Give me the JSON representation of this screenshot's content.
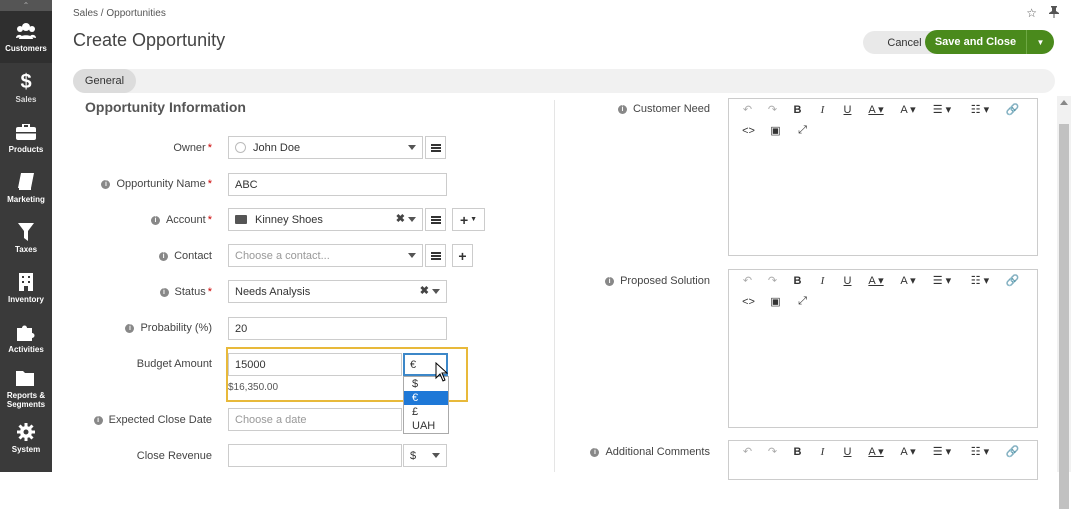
{
  "sidebar": {
    "items": [
      {
        "label": "Customers",
        "icon": "users-icon"
      },
      {
        "label": "Sales",
        "icon": "dollar-icon"
      },
      {
        "label": "Products",
        "icon": "briefcase-icon"
      },
      {
        "label": "Marketing",
        "icon": "book-icon"
      },
      {
        "label": "Taxes",
        "icon": "filter-icon"
      },
      {
        "label": "Inventory",
        "icon": "building-icon"
      },
      {
        "label": "Activities",
        "icon": "puzzle-icon"
      },
      {
        "label": "Reports & Segments",
        "icon": "folder-icon"
      },
      {
        "label": "System",
        "icon": "gear-icon"
      }
    ]
  },
  "header": {
    "breadcrumb": "Sales / Opportunities",
    "title": "Create Opportunity",
    "cancel_label": "Cancel",
    "save_label": "Save and Close"
  },
  "tabs": [
    {
      "label": "General"
    }
  ],
  "section": {
    "title": "Opportunity Information"
  },
  "form": {
    "owner": {
      "label": "Owner",
      "value": "John Doe"
    },
    "opportunity_name": {
      "label": "Opportunity Name",
      "value": "ABC"
    },
    "account": {
      "label": "Account",
      "value": "Kinney Shoes"
    },
    "contact": {
      "label": "Contact",
      "placeholder": "Choose a contact..."
    },
    "status": {
      "label": "Status",
      "value": "Needs Analysis"
    },
    "probability": {
      "label": "Probability (%)",
      "value": "20"
    },
    "budget_amount": {
      "label": "Budget Amount",
      "value": "15000",
      "currency": "€",
      "converted": "$16,350.00"
    },
    "currency_options": [
      "$",
      "€",
      "£",
      "UAH"
    ],
    "currency_selected": "€",
    "expected_close_date": {
      "label": "Expected Close Date",
      "placeholder": "Choose a date"
    },
    "close_revenue": {
      "label": "Close Revenue",
      "value": "",
      "currency": "$"
    }
  },
  "right": {
    "customer_need": {
      "label": "Customer Need"
    },
    "proposed_solution": {
      "label": "Proposed Solution"
    },
    "additional_comments": {
      "label": "Additional Comments"
    }
  },
  "editor_toolbar": {
    "row1": [
      "↶",
      "↷",
      "B",
      "I",
      "U",
      "A ▾",
      "A ▾",
      "☰ ▾",
      "☷ ▾",
      "🔗"
    ],
    "row2": [
      "<>",
      "▣",
      "⤢"
    ]
  },
  "colors": {
    "accent": "#4a8a1c",
    "sidebar": "#3a3a3a",
    "highlight": "#e8b93a",
    "select_blue": "#1e78d7"
  }
}
